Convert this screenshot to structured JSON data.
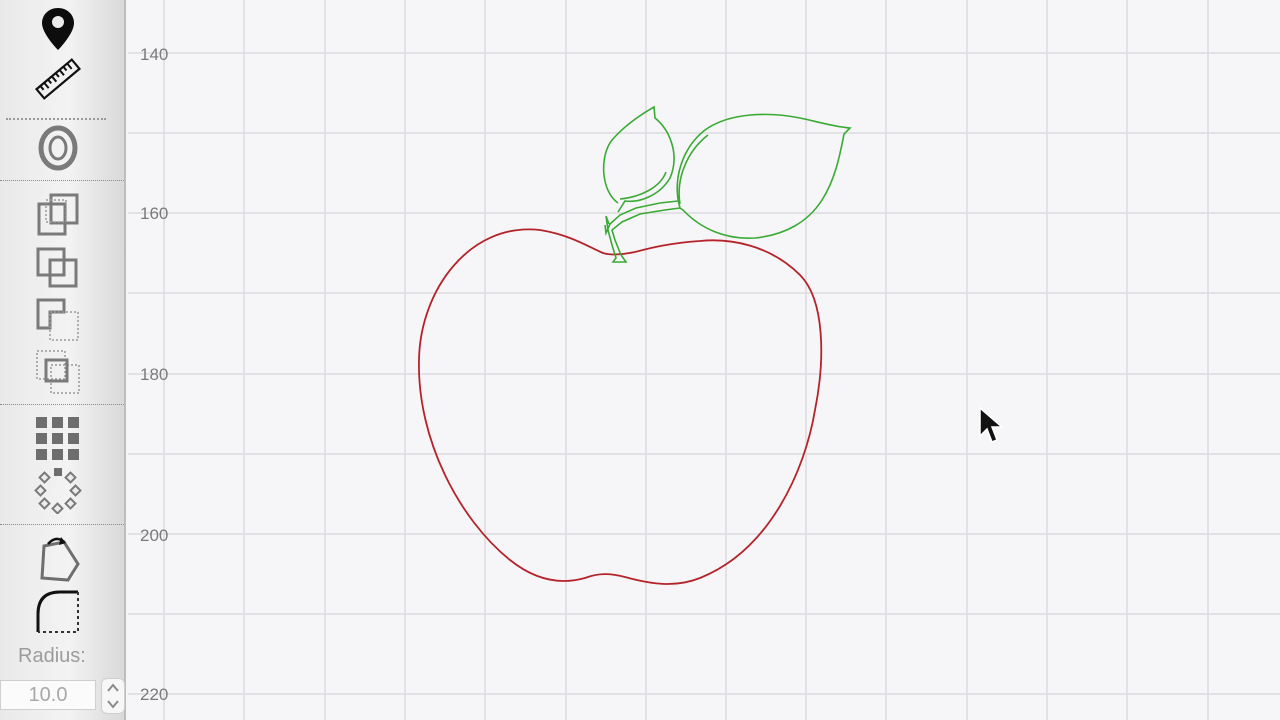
{
  "toolbar": {
    "tools": [
      {
        "icon": "map-pin-icon"
      },
      {
        "icon": "ruler-icon"
      },
      {
        "icon": "offset-outline-icon"
      },
      {
        "icon": "weld-icon"
      },
      {
        "icon": "attach-icon"
      },
      {
        "icon": "subtract-icon"
      },
      {
        "icon": "intersect-icon"
      },
      {
        "icon": "grid-array-icon"
      },
      {
        "icon": "radial-array-icon"
      },
      {
        "icon": "rotate-node-icon"
      },
      {
        "icon": "round-corner-icon"
      }
    ],
    "radius_label": "Radius:",
    "radius_value": "10.0"
  },
  "ruler": {
    "y_ticks": [
      "140",
      "160",
      "180",
      "200",
      "220"
    ]
  },
  "shapes": [
    {
      "name": "apple-body",
      "color": "#b5232a"
    },
    {
      "name": "apple-leaves-and-stem",
      "color": "#3aaa35"
    }
  ],
  "colors": {
    "canvas_background": "#f6f6f8",
    "grid": "#dcdcdf",
    "toolbar": "#ececec"
  }
}
